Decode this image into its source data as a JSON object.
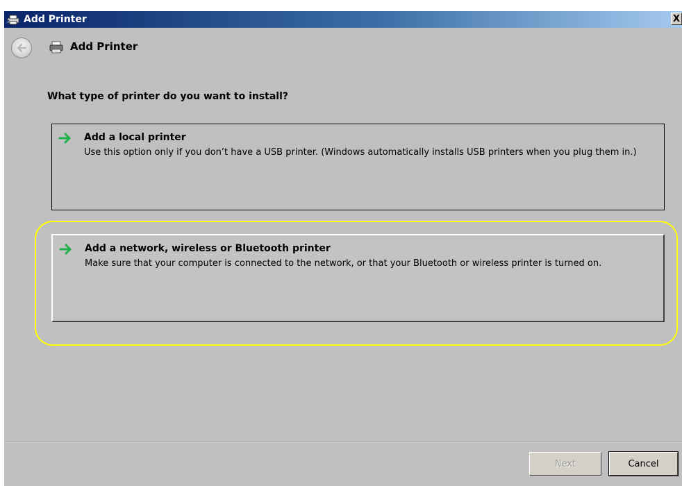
{
  "window": {
    "title": "Add Printer",
    "close_label": "X"
  },
  "header": {
    "title": "Add Printer"
  },
  "main": {
    "question": "What type of printer do you want to install?",
    "options": [
      {
        "title": "Add a local printer",
        "description": "Use this option only if you don’t have a USB printer. (Windows automatically installs USB printers when you plug them in.)"
      },
      {
        "title": "Add a network, wireless or Bluetooth printer",
        "description": "Make sure that your computer is connected to the network, or that your Bluetooth or wireless printer is turned on."
      }
    ]
  },
  "footer": {
    "next_label": "Next",
    "cancel_label": "Cancel"
  },
  "icons": {
    "title": "printer-icon",
    "back": "back-arrow-icon",
    "header": "printer-icon",
    "option_arrow": "green-arrow-icon"
  },
  "colors": {
    "highlight": "#ffff00",
    "arrow_green": "#22b14c",
    "title_bar": "#0a246a"
  }
}
